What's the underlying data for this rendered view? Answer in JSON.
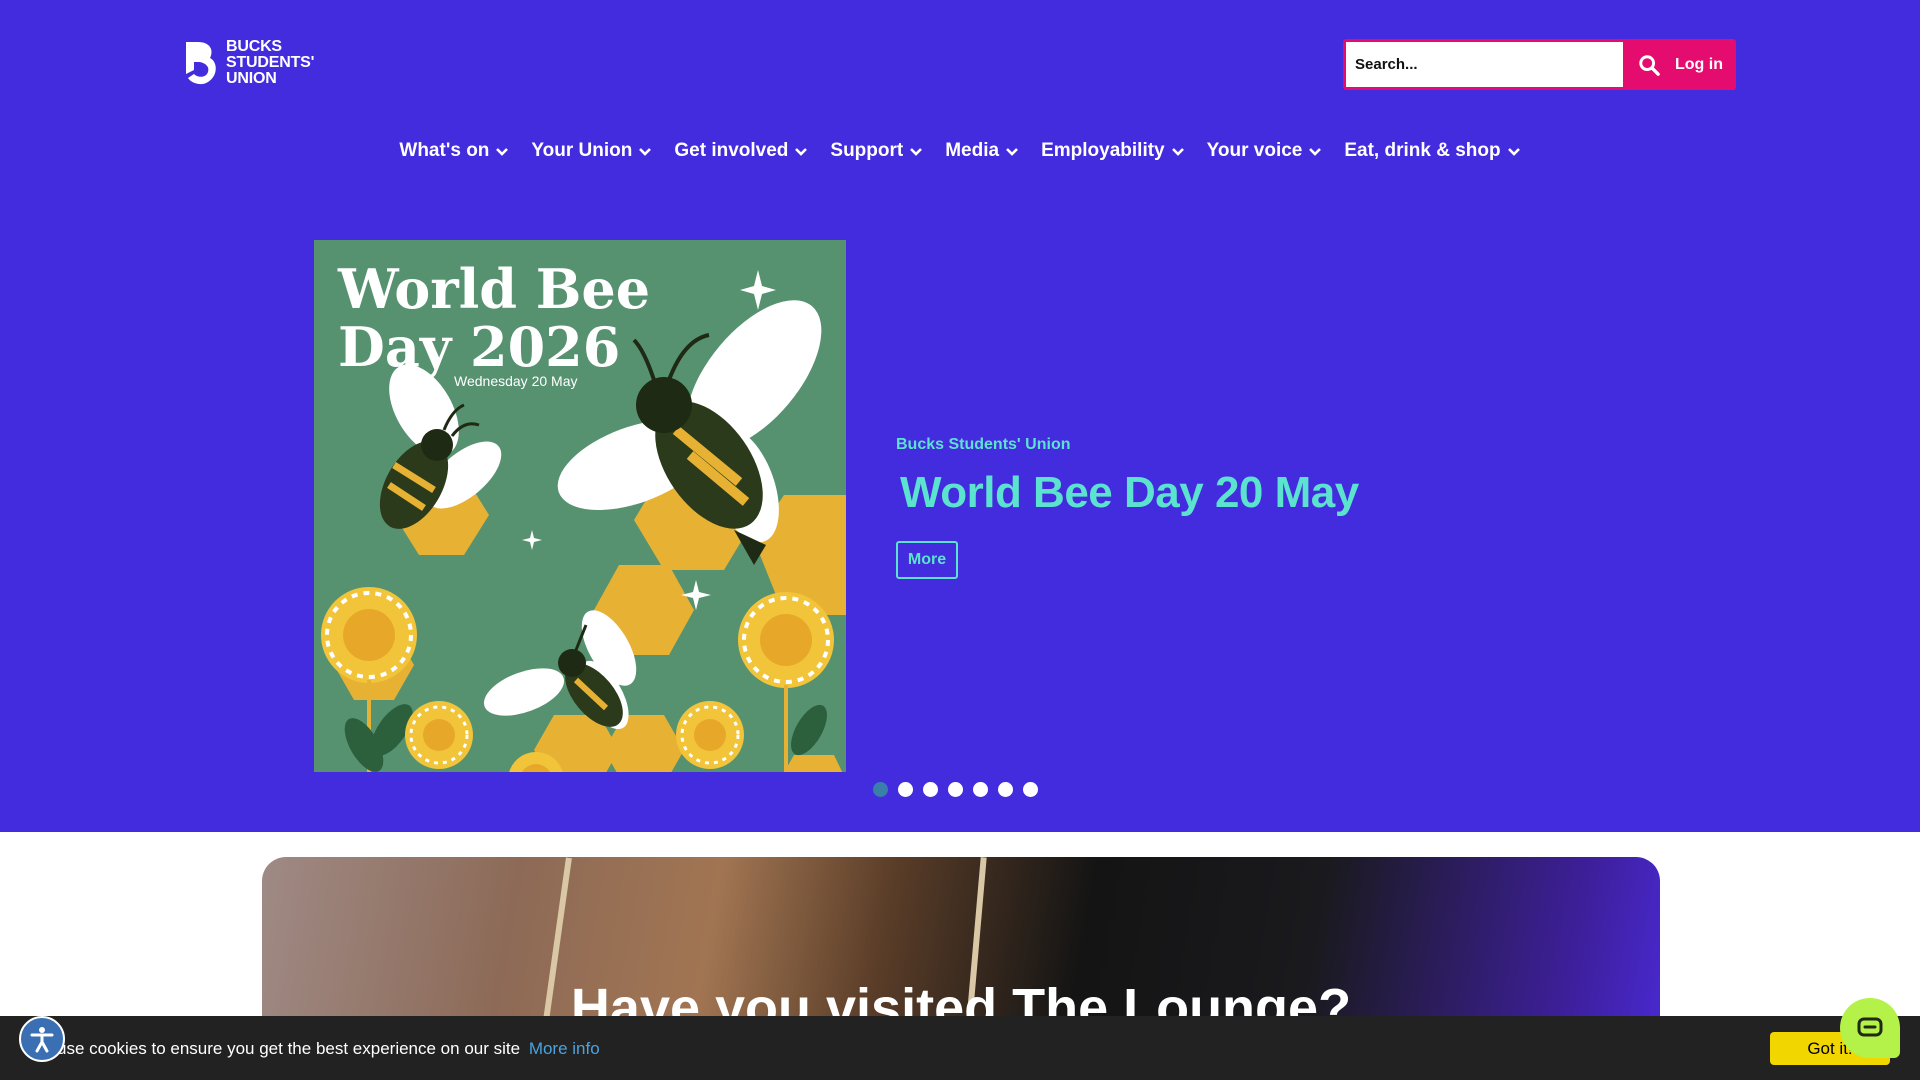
{
  "header": {
    "logo_lines": [
      "BUCKS",
      "STUDENTS'",
      "UNION"
    ],
    "search_placeholder": "Search...",
    "search_icon": "search-icon",
    "login_label": "Log in"
  },
  "nav": {
    "items": [
      {
        "label": "What's on"
      },
      {
        "label": "Your Union"
      },
      {
        "label": "Get involved"
      },
      {
        "label": "Support"
      },
      {
        "label": "Media"
      },
      {
        "label": "Employability"
      },
      {
        "label": "Your voice"
      },
      {
        "label": "Eat, drink & shop"
      }
    ]
  },
  "slider": {
    "image_title_line1": "World Bee",
    "image_title_line2": "Day 2026",
    "image_date": "Wednesday 20 May",
    "org": "Bucks Students' Union",
    "title": "World Bee Day 20 May",
    "more_label": "More",
    "dots_count": 7,
    "active_dot": 1
  },
  "lounge": {
    "title": "Have you visited The Lounge?"
  },
  "cookie": {
    "text": "use cookies to ensure you get the best experience on our site",
    "link": "More info",
    "button": "Got it!"
  },
  "colors": {
    "brand_purple": "#432bde",
    "accent_pink": "#e50c6f",
    "accent_teal": "#5ce3cf",
    "cookie_yellow": "#f1d600",
    "chat_green": "#b4f24a"
  }
}
